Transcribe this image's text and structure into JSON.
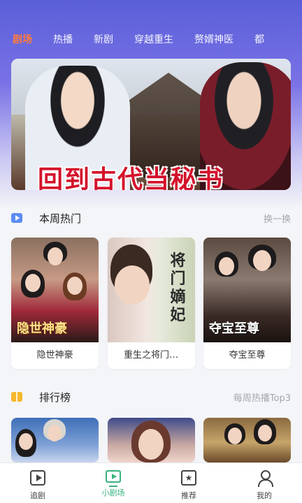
{
  "tabs": [
    "剧场",
    "热播",
    "新剧",
    "穿越重生",
    "赘婿神医",
    "都"
  ],
  "banner": {
    "caption": "回到古代当秘书"
  },
  "weekly_hot": {
    "title": "本周热门",
    "action": "换一换",
    "items": [
      {
        "name": "隐世神豪",
        "poster_text": "隐世神豪"
      },
      {
        "name": "重生之将门…",
        "poster_text": "将门嫡妃"
      },
      {
        "name": "夺宝至尊",
        "poster_text": "夺宝至尊"
      }
    ]
  },
  "ranking": {
    "title": "排行榜",
    "action": "每周热播Top3"
  },
  "bottom_nav": [
    {
      "label": "追剧",
      "icon": "play-square-icon"
    },
    {
      "label": "小剧场",
      "icon": "tv-icon",
      "active": true
    },
    {
      "label": "推荐",
      "icon": "star-badge-icon"
    },
    {
      "label": "我的",
      "icon": "user-icon"
    }
  ],
  "colors": {
    "active_tab": "#ff7a3d",
    "active_nav": "#36b37e",
    "header_gradient": "#5a5fd8"
  }
}
